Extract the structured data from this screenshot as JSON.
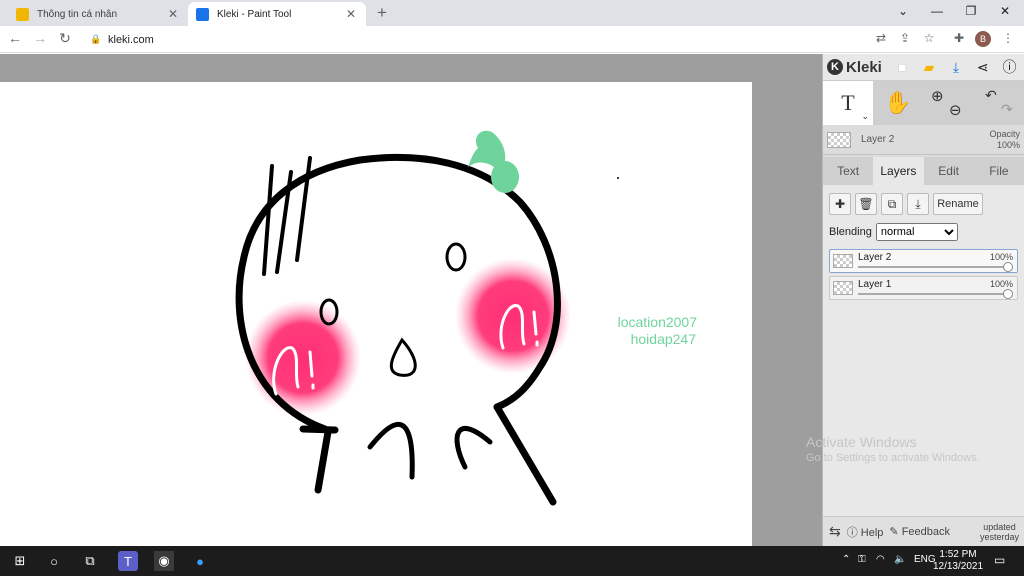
{
  "browser": {
    "tabs": [
      {
        "title": "Thông tin cá nhân",
        "favicon_color": "#f2b705"
      },
      {
        "title": "Kleki - Paint Tool",
        "favicon_color": "#1a73e8"
      }
    ],
    "url": "kleki.com",
    "profile_initial": "B"
  },
  "kleki": {
    "brand": "Kleki",
    "active_layer_name": "Layer 2",
    "opacity_label": "Opacity",
    "opacity_value": "100%",
    "tabs": [
      "Text",
      "Layers",
      "Edit",
      "File"
    ],
    "selected_tab": "Layers",
    "rename_label": "Rename",
    "blending_label": "Blending",
    "blending_value": "normal",
    "layers": [
      {
        "name": "Layer 2",
        "opacity": "100%",
        "selected": true
      },
      {
        "name": "Layer 1",
        "opacity": "100%",
        "selected": false
      }
    ],
    "help_label": "Help",
    "feedback_label": "Feedback",
    "updated_line1": "updated",
    "updated_line2": "yesterday"
  },
  "canvas": {
    "texts": [
      "location2007",
      "hoidap247"
    ],
    "text_color": "#6fd49b"
  },
  "watermark": {
    "line1": "Activate Windows",
    "line2": "Go to Settings to activate Windows."
  },
  "taskbar": {
    "language": "ENG",
    "time": "1:52 PM",
    "date": "12/13/2021"
  }
}
